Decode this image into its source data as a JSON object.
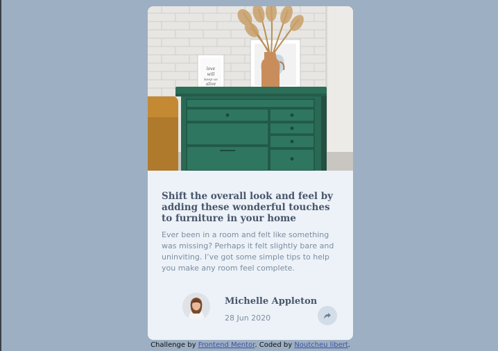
{
  "article": {
    "title": "Shift the overall look and feel by adding these wonderful touches to furniture in your home",
    "description": "Ever been in a room and felt like something was missing? Perhaps it felt slightly bare and uninviting. I’ve got some simple tips to help you make any room feel complete.",
    "frame_text": "love will keep us alive"
  },
  "author": {
    "name": "Michelle Appleton",
    "date": "28 Jun 2020"
  },
  "share": {
    "icon": "share-icon"
  },
  "attribution": {
    "prefix": "Challenge by ",
    "frontend_link": "Frontend Mentor",
    "middle": ". Coded by ",
    "author_link": "Noutcheu libert",
    "suffix": "."
  },
  "colors": {
    "page_bg": "#9dafc2",
    "card_bg": "#ecf2f8",
    "title": "#48556a",
    "muted": "#7c8ca0",
    "drawer_green": "#2c6e58",
    "link": "#3e52a3"
  }
}
